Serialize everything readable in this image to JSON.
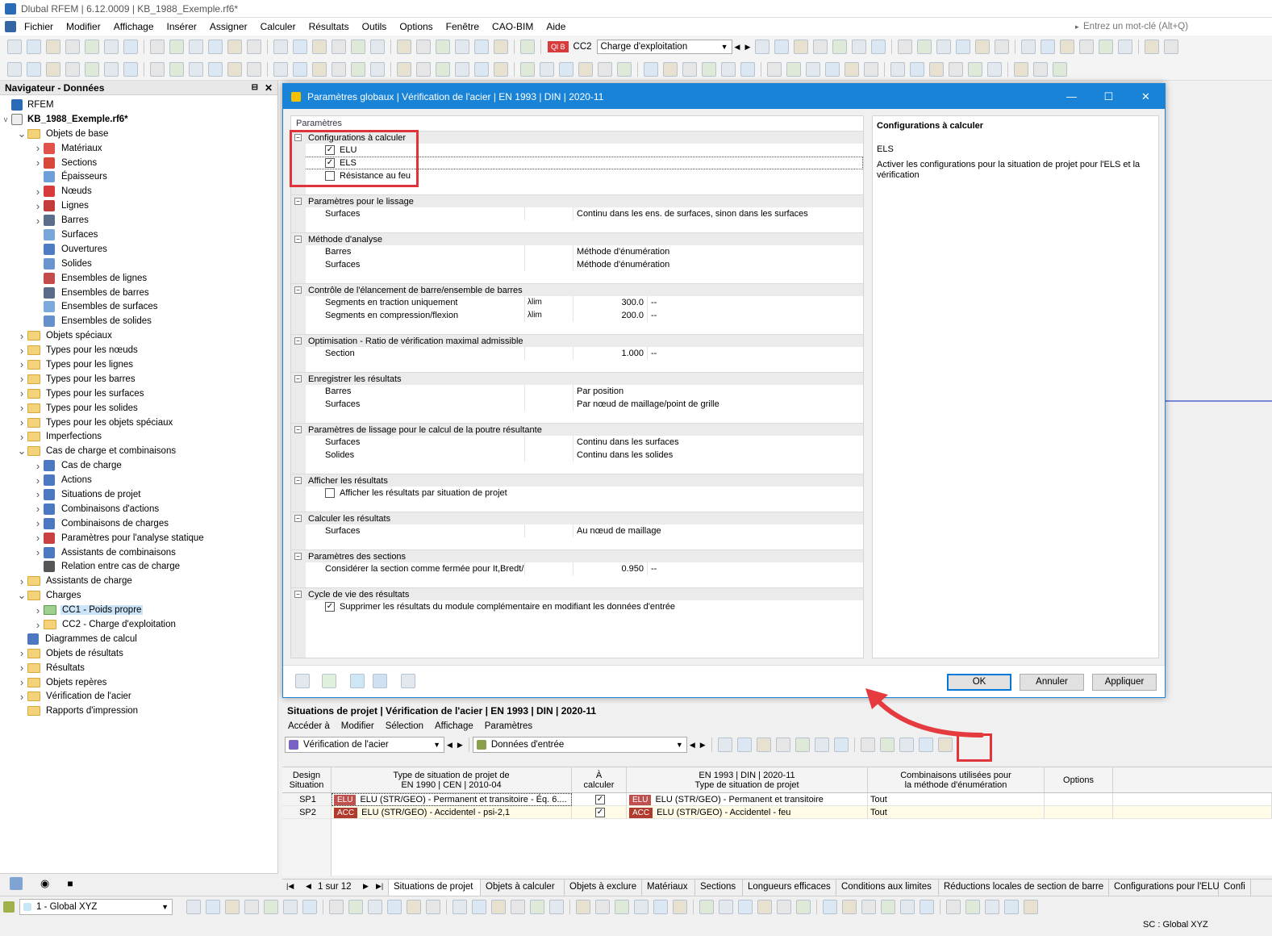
{
  "app": {
    "title": "Dlubal RFEM | 6.12.0009 | KB_1988_Exemple.rf6*",
    "menu": [
      "Fichier",
      "Modifier",
      "Affichage",
      "Insérer",
      "Assigner",
      "Calculer",
      "Résultats",
      "Outils",
      "Options",
      "Fenêtre",
      "CAO-BIM",
      "Aide"
    ],
    "search_placeholder": "Entrez un mot-clé (Alt+Q)",
    "loadcase_badge": "Ql B",
    "loadcase_id": "CC2",
    "loadcase_name": "Charge d'exploitation"
  },
  "navigator": {
    "title": "Navigateur - Données",
    "root": "RFEM",
    "file": "KB_1988_Exemple.rf6*",
    "items": [
      {
        "label": "Objets de base",
        "level": 1,
        "exp": "v",
        "type": "folder"
      },
      {
        "label": "Matériaux",
        "level": 2,
        "exp": ">",
        "type": "icon",
        "color": "#e0524b"
      },
      {
        "label": "Sections",
        "level": 2,
        "exp": ">",
        "type": "icon",
        "color": "#d8483a"
      },
      {
        "label": "Épaisseurs",
        "level": 2,
        "exp": "",
        "type": "icon",
        "color": "#6f9fd8"
      },
      {
        "label": "Nœuds",
        "level": 2,
        "exp": ">",
        "type": "icon",
        "color": "#d73b3b"
      },
      {
        "label": "Lignes",
        "level": 2,
        "exp": ">",
        "type": "icon",
        "color": "#c43b3b"
      },
      {
        "label": "Barres",
        "level": 2,
        "exp": ">",
        "type": "icon",
        "color": "#5a6d8a"
      },
      {
        "label": "Surfaces",
        "level": 2,
        "exp": "",
        "type": "icon",
        "color": "#7aa7da"
      },
      {
        "label": "Ouvertures",
        "level": 2,
        "exp": "",
        "type": "icon",
        "color": "#4d7cc2"
      },
      {
        "label": "Solides",
        "level": 2,
        "exp": "",
        "type": "icon",
        "color": "#6b95cf"
      },
      {
        "label": "Ensembles de lignes",
        "level": 2,
        "exp": "",
        "type": "icon",
        "color": "#c44b4b"
      },
      {
        "label": "Ensembles de barres",
        "level": 2,
        "exp": "",
        "type": "icon",
        "color": "#586b88"
      },
      {
        "label": "Ensembles de surfaces",
        "level": 2,
        "exp": "",
        "type": "icon",
        "color": "#7ea9dc"
      },
      {
        "label": "Ensembles de solides",
        "level": 2,
        "exp": "",
        "type": "icon",
        "color": "#6690cc"
      },
      {
        "label": "Objets spéciaux",
        "level": 1,
        "exp": ">",
        "type": "folder"
      },
      {
        "label": "Types pour les nœuds",
        "level": 1,
        "exp": ">",
        "type": "folder"
      },
      {
        "label": "Types pour les lignes",
        "level": 1,
        "exp": ">",
        "type": "folder"
      },
      {
        "label": "Types pour les barres",
        "level": 1,
        "exp": ">",
        "type": "folder"
      },
      {
        "label": "Types pour les surfaces",
        "level": 1,
        "exp": ">",
        "type": "folder"
      },
      {
        "label": "Types pour les solides",
        "level": 1,
        "exp": ">",
        "type": "folder"
      },
      {
        "label": "Types pour les objets spéciaux",
        "level": 1,
        "exp": ">",
        "type": "folder"
      },
      {
        "label": "Imperfections",
        "level": 1,
        "exp": ">",
        "type": "folder"
      },
      {
        "label": "Cas de charge et combinaisons",
        "level": 1,
        "exp": "v",
        "type": "folder"
      },
      {
        "label": "Cas de charge",
        "level": 2,
        "exp": ">",
        "type": "icon",
        "color": "#4b78c0"
      },
      {
        "label": "Actions",
        "level": 2,
        "exp": ">",
        "type": "icon",
        "color": "#4b78c0"
      },
      {
        "label": "Situations de projet",
        "level": 2,
        "exp": ">",
        "type": "icon",
        "color": "#4b78c0"
      },
      {
        "label": "Combinaisons d'actions",
        "level": 2,
        "exp": ">",
        "type": "icon",
        "color": "#4b78c0"
      },
      {
        "label": "Combinaisons de charges",
        "level": 2,
        "exp": ">",
        "type": "icon",
        "color": "#4b78c0"
      },
      {
        "label": "Paramètres pour l'analyse statique",
        "level": 2,
        "exp": ">",
        "type": "icon",
        "color": "#c94040"
      },
      {
        "label": "Assistants de combinaisons",
        "level": 2,
        "exp": ">",
        "type": "icon",
        "color": "#4b78c0"
      },
      {
        "label": "Relation entre cas de charge",
        "level": 2,
        "exp": "",
        "type": "icon",
        "color": "#555555"
      },
      {
        "label": "Assistants de charge",
        "level": 1,
        "exp": ">",
        "type": "folder"
      },
      {
        "label": "Charges",
        "level": 1,
        "exp": "v",
        "type": "folder"
      },
      {
        "label": "CC1 - Poids propre",
        "level": 2,
        "exp": ">",
        "type": "greenfolder",
        "selected": true
      },
      {
        "label": "CC2 - Charge d'exploitation",
        "level": 2,
        "exp": ">",
        "type": "folder"
      },
      {
        "label": "Diagrammes de calcul",
        "level": 1,
        "exp": "",
        "type": "icon",
        "color": "#4b78c0"
      },
      {
        "label": "Objets de résultats",
        "level": 1,
        "exp": ">",
        "type": "folder"
      },
      {
        "label": "Résultats",
        "level": 1,
        "exp": ">",
        "type": "folder"
      },
      {
        "label": "Objets repères",
        "level": 1,
        "exp": ">",
        "type": "folder"
      },
      {
        "label": "Vérification de l'acier",
        "level": 1,
        "exp": ">",
        "type": "folder"
      },
      {
        "label": "Rapports d'impression",
        "level": 1,
        "exp": "",
        "type": "folder"
      }
    ]
  },
  "dialog": {
    "title": "Paramètres globaux | Vérification de l'acier | EN 1993 | DIN | 2020-11",
    "params_header": "Paramètres",
    "sections": [
      {
        "title": "Configurations à calculer",
        "rows": [
          {
            "kind": "check",
            "label": "ELU",
            "checked": true
          },
          {
            "kind": "check",
            "label": "ELS",
            "checked": true,
            "focus": true
          },
          {
            "kind": "check",
            "label": "Résistance au feu",
            "checked": false
          }
        ]
      },
      {
        "title": "Paramètres pour le lissage",
        "rows": [
          {
            "kind": "text",
            "label": "Surfaces",
            "value": "Continu dans les ens. de surfaces, sinon dans les surfaces"
          }
        ]
      },
      {
        "title": "Méthode d'analyse",
        "rows": [
          {
            "kind": "text",
            "label": "Barres",
            "value": "Méthode d'énumération"
          },
          {
            "kind": "text",
            "label": "Surfaces",
            "value": "Méthode d'énumération"
          }
        ]
      },
      {
        "title": "Contrôle de l'élancement de barre/ensemble de barres",
        "rows": [
          {
            "kind": "num",
            "label": "Segments en traction uniquement",
            "sym": "λlim",
            "value": "300.0",
            "unit": "--"
          },
          {
            "kind": "num",
            "label": "Segments en compression/flexion",
            "sym": "λlim",
            "value": "200.0",
            "unit": "--"
          }
        ]
      },
      {
        "title": "Optimisation - Ratio de vérification maximal admissible",
        "rows": [
          {
            "kind": "num",
            "label": "Section",
            "sym": "",
            "value": "1.000",
            "unit": "--"
          }
        ]
      },
      {
        "title": "Enregistrer les résultats",
        "rows": [
          {
            "kind": "text",
            "label": "Barres",
            "value": "Par position"
          },
          {
            "kind": "text",
            "label": "Surfaces",
            "value": "Par nœud de maillage/point de grille"
          }
        ]
      },
      {
        "title": "Paramètres de lissage pour le calcul de la poutre résultante",
        "rows": [
          {
            "kind": "text",
            "label": "Surfaces",
            "value": "Continu dans les surfaces"
          },
          {
            "kind": "text",
            "label": "Solides",
            "value": "Continu dans les solides"
          }
        ]
      },
      {
        "title": "Afficher les résultats",
        "rows": [
          {
            "kind": "check",
            "label": "Afficher les résultats par situation de projet",
            "checked": false
          }
        ]
      },
      {
        "title": "Calculer les résultats",
        "rows": [
          {
            "kind": "text",
            "label": "Surfaces",
            "value": "Au nœud de maillage"
          }
        ]
      },
      {
        "title": "Paramètres des sections",
        "rows": [
          {
            "kind": "num",
            "label": "Considérer la section comme fermée pour It,Bredt/It s…",
            "sym": "",
            "value": "0.950",
            "unit": "--"
          }
        ]
      },
      {
        "title": "Cycle de vie des résultats",
        "rows": [
          {
            "kind": "check",
            "label": "Supprimer les résultats du module complémentaire en modifiant les données d'entrée",
            "checked": true
          }
        ]
      }
    ],
    "desc_title": "Configurations à calculer",
    "desc_sub": "ELS",
    "desc_text": "Activer les configurations pour la situation de projet pour l'ELS et la vérification",
    "buttons": {
      "ok": "OK",
      "cancel": "Annuler",
      "apply": "Appliquer"
    }
  },
  "bottom": {
    "title": "Situations de projet | Vérification de l'acier | EN 1993 | DIN | 2020-11",
    "menu": [
      "Accéder à",
      "Modifier",
      "Sélection",
      "Affichage",
      "Paramètres"
    ],
    "module_combo": "Vérification de l'acier",
    "data_combo": "Données d'entrée",
    "columns": {
      "c0": [
        "Design",
        "Situation"
      ],
      "c1": [
        "Type de situation de projet de",
        "EN 1990 | CEN | 2010-04"
      ],
      "c2": [
        "À",
        "calculer"
      ],
      "c3": [
        "EN 1993 | DIN | 2020-11",
        "Type de situation de projet"
      ],
      "c4": [
        "Combinaisons utilisées pour",
        "la méthode d'énumération"
      ],
      "c5": [
        "Options",
        ""
      ]
    },
    "rows": [
      {
        "id": "SP1",
        "badge1": "ELU",
        "badge1_color": "#c0504d",
        "type": "ELU (STR/GEO) - Permanent et transitoire - Éq. 6....",
        "calc": true,
        "badge2": "ELU",
        "badge2_color": "#c0504d",
        "din": "ELU (STR/GEO) - Permanent et transitoire",
        "comb": "Tout"
      },
      {
        "id": "SP2",
        "badge1": "ACC",
        "badge1_color": "#b03a2e",
        "type": "ELU (STR/GEO) - Accidentel - psi-2,1",
        "calc": true,
        "badge2": "ACC",
        "badge2_color": "#b03a2e",
        "din": "ELU (STR/GEO) - Accidentel - feu",
        "comb": "Tout"
      }
    ],
    "pager": "1 sur 12",
    "tabs": [
      "Situations de projet",
      "Objets à calculer",
      "Objets à exclure",
      "Matériaux",
      "Sections",
      "Longueurs efficaces",
      "Conditions aux limites",
      "Réductions locales de section de barre",
      "Configurations pour l'ELU",
      "Confi"
    ]
  },
  "status": {
    "cs_combo": "1 - Global XYZ",
    "cs_label": "SC : Global XYZ"
  },
  "colors": {
    "accent": "#1883d7",
    "highlight": "#e0343a"
  }
}
